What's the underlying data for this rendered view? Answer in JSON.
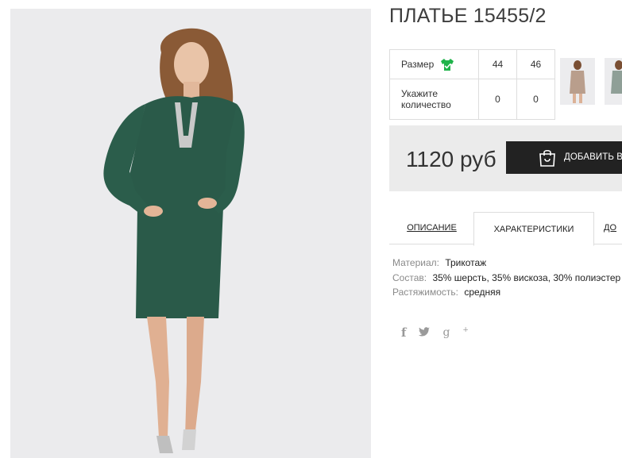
{
  "product": {
    "title": "ПЛАТЬЕ 15455/2",
    "image_alt": "green knit dress",
    "dress_color": "#2a5a49"
  },
  "size_table": {
    "size_label": "Размер",
    "size_icon": "green-shirt-check-icon",
    "sizes": [
      "44",
      "46"
    ],
    "qty_label_line1": "Укажите",
    "qty_label_line2": "количество",
    "quantities": [
      "0",
      "0"
    ]
  },
  "buy": {
    "price": "1120 руб",
    "add_label": "ДОБАВИТЬ В",
    "bag_icon": "shopping-bag-icon"
  },
  "tabs": [
    {
      "label": "ОПИСАНИЕ",
      "active": false
    },
    {
      "label": "ХАРАКТЕРИСТИКИ",
      "active": true
    },
    {
      "label": "ДО",
      "active": false
    }
  ],
  "characteristics": [
    {
      "key": "Материал:",
      "value": "Трикотаж"
    },
    {
      "key": "Состав:",
      "value": "35% шерсть, 35% вискоза, 30% полиэстер"
    },
    {
      "key": "Растяжимость:",
      "value": "средняя"
    }
  ],
  "social": {
    "facebook": "f",
    "twitter_icon": "twitter-bird-icon",
    "gplus": "g",
    "gplus_sup": "+"
  },
  "colors": {
    "accent_green": "#1fb34a",
    "button_bg": "#222222",
    "price_box_bg": "#ebebeb"
  }
}
